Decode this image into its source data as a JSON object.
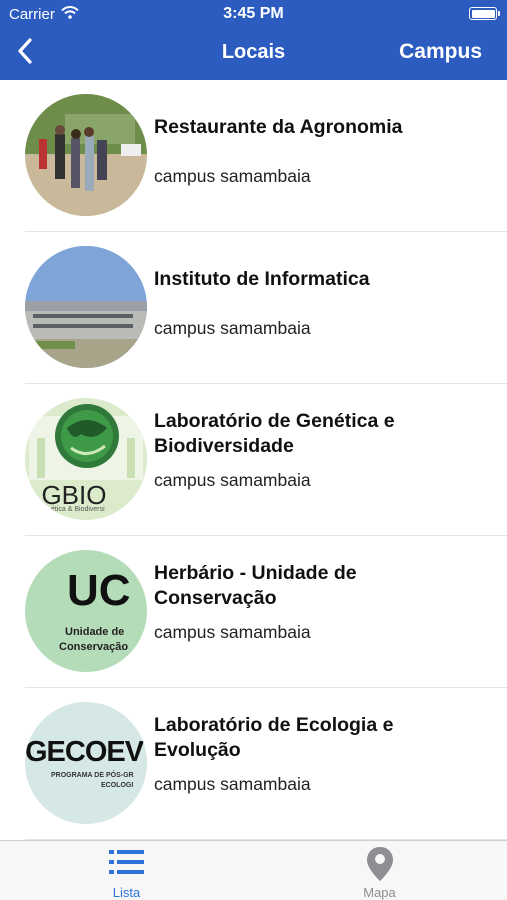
{
  "status_bar": {
    "carrier": "Carrier",
    "time": "3:45 PM"
  },
  "nav": {
    "title": "Locais",
    "right_button": "Campus",
    "back_icon": "chevron-left-icon"
  },
  "places": [
    {
      "name": "Restaurante da Agronomia",
      "campus": "campus samambaia"
    },
    {
      "name": "Instituto de Informatica",
      "campus": "campus samambaia"
    },
    {
      "name": "Laboratório de Genética e Biodiversidade",
      "campus": "campus samambaia",
      "logo_text": "LGBIO",
      "logo_subtext": "ética & Biodiversi"
    },
    {
      "name": "Herbário - Unidade de Conservação",
      "campus": "campus samambaia",
      "logo_text": "UC",
      "logo_subtext_1": "Unidade de",
      "logo_subtext_2": "Conservação"
    },
    {
      "name": "Laboratório de Ecologia e Evolução",
      "campus": "campus samambaia",
      "logo_text": "GECOEV",
      "logo_subtext_1": "PROGRAMA DE PÓS-GR",
      "logo_subtext_2": "ECOLOGI"
    }
  ],
  "tabbar": {
    "tabs": [
      {
        "label": "Lista",
        "icon": "list-icon",
        "active": true
      },
      {
        "label": "Mapa",
        "icon": "map-pin-icon",
        "active": false
      }
    ]
  },
  "colors": {
    "nav_bg": "#2d5cc0",
    "tab_active": "#2d73d8",
    "tab_inactive": "#8e8e93"
  }
}
